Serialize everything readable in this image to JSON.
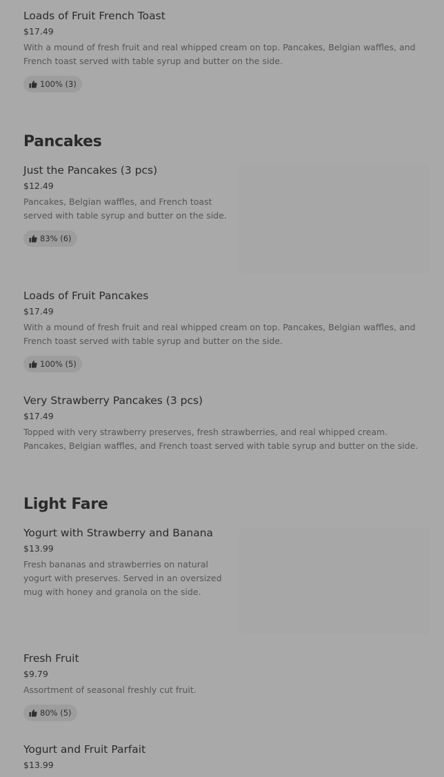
{
  "sections": [
    {
      "title": "",
      "items": [
        {
          "name": "Loads of Fruit French Toast",
          "price": "$17.49",
          "description": "With a mound of fresh fruit and real whipped cream on top. Pancakes, Belgian waffles, and French toast served with table syrup and butter on the side.",
          "rating": "100% (3)"
        }
      ]
    },
    {
      "title": "Pancakes",
      "items": [
        {
          "name": "Just the Pancakes (3 pcs)",
          "price": "$12.49",
          "description": "Pancakes, Belgian waffles, and French toast served with table syrup and butter on the side.",
          "rating": "83% (6)"
        },
        {
          "name": "Loads of Fruit Pancakes",
          "price": "$17.49",
          "description": "With a mound of fresh fruit and real whipped cream on top. Pancakes, Belgian waffles, and French toast served with table syrup and butter on the side.",
          "rating": "100% (5)"
        },
        {
          "name": "Very Strawberry Pancakes (3 pcs)",
          "price": "$17.49",
          "description": "Topped with very strawberry preserves, fresh strawberries, and real whipped cream. Pancakes, Belgian waffles, and French toast served with table syrup and butter on the side."
        }
      ]
    },
    {
      "title": "Light Fare",
      "items": [
        {
          "name": "Yogurt with Strawberry and Banana",
          "price": "$13.99",
          "description": "Fresh bananas and strawberries on natural yogurt with preserves. Served in an oversized mug with honey and granola on the side."
        },
        {
          "name": "Fresh Fruit",
          "price": "$9.79",
          "description": "Assortment of seasonal freshly cut fruit.",
          "rating": "80% (5)"
        },
        {
          "name": "Yogurt and Fruit Parfait",
          "price": "$13.99"
        }
      ]
    }
  ],
  "icons": {
    "rating": "thumbs-up-icon"
  },
  "colors": {
    "background": "#a9a9a9",
    "text": "#2a2a2a",
    "description": "#555555",
    "badge": "#9d9d9d",
    "image_placeholder": "#a7a7a7"
  }
}
